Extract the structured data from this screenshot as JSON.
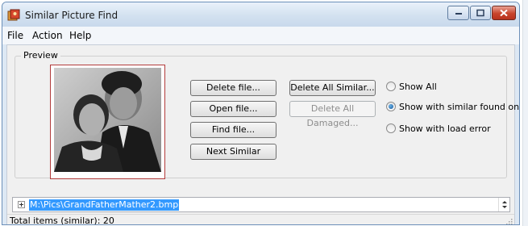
{
  "window": {
    "title": "Similar Picture Find"
  },
  "menu": {
    "items": [
      "File",
      "Action",
      "Help"
    ]
  },
  "preview": {
    "group_label": "Preview"
  },
  "buttons": {
    "delete_file": "Delete file...",
    "open_file": "Open file...",
    "find_file": "Find file...",
    "next_similar": "Next Similar",
    "delete_all_similar": "Delete All Similar...",
    "delete_all_damaged": "Delete All Damaged..."
  },
  "filter": {
    "options": [
      {
        "label": "Show All",
        "checked": false
      },
      {
        "label": "Show with similar found only",
        "checked": true
      },
      {
        "label": "Show with load error",
        "checked": false
      }
    ]
  },
  "path": {
    "value": "M:\\Pics\\GrandFatherMather2.bmp"
  },
  "status": {
    "text": "Total items (similar): 20"
  },
  "icons": {
    "app": "photos-app-icon",
    "minimize": "minimize-icon",
    "maximize": "maximize-icon",
    "close": "close-icon",
    "expand": "plus-expand-icon",
    "spinner": "up-down-spinner-icon",
    "grip": "resize-grip-icon"
  },
  "colors": {
    "selection": "#3399ff",
    "preview_border": "#b23b3b",
    "close_button": "#c8442b"
  }
}
